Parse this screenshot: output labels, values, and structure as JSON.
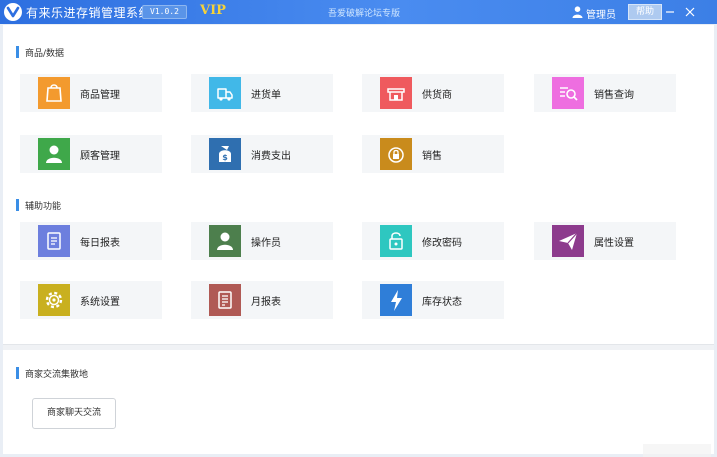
{
  "titlebar": {
    "app_title": "有来乐进存销管理系统",
    "version": "V1.0.2",
    "vip_label": "VIP",
    "forum_text": "吾爱破解论坛专版",
    "user_label": "管理员",
    "help_label": "帮助"
  },
  "sections": {
    "goods": {
      "title": "商品/数据",
      "tiles": [
        {
          "label": "商品管理",
          "icon": "bag-icon",
          "color": "#f39a2e"
        },
        {
          "label": "进货单",
          "icon": "truck-icon",
          "color": "#41b8e8"
        },
        {
          "label": "供货商",
          "icon": "store-icon",
          "color": "#ef5a5e"
        },
        {
          "label": "销售查询",
          "icon": "search-list-icon",
          "color": "#ee6ee0"
        },
        {
          "label": "顾客管理",
          "icon": "person-icon",
          "color": "#3fa84a"
        },
        {
          "label": "消费支出",
          "icon": "money-bag-icon",
          "color": "#2f6fb0"
        },
        {
          "label": "销售",
          "icon": "lock-bag-icon",
          "color": "#c98b1c"
        }
      ]
    },
    "aux": {
      "title": "辅助功能",
      "tiles": [
        {
          "label": "每日报表",
          "icon": "report-icon",
          "color": "#6d7fde"
        },
        {
          "label": "操作员",
          "icon": "operator-icon",
          "color": "#4d7f4d"
        },
        {
          "label": "修改密码",
          "icon": "password-icon",
          "color": "#2ec7c0"
        },
        {
          "label": "属性设置",
          "icon": "paper-plane-icon",
          "color": "#8d3b8d"
        },
        {
          "label": "系统设置",
          "icon": "gear-icon",
          "color": "#c9b01f"
        },
        {
          "label": "月报表",
          "icon": "document-icon",
          "color": "#b05a55"
        },
        {
          "label": "库存状态",
          "icon": "lightning-icon",
          "color": "#2f7ed8"
        }
      ]
    },
    "exchange": {
      "title": "商家交流集散地",
      "chat_button": "商家聊天交流"
    }
  }
}
